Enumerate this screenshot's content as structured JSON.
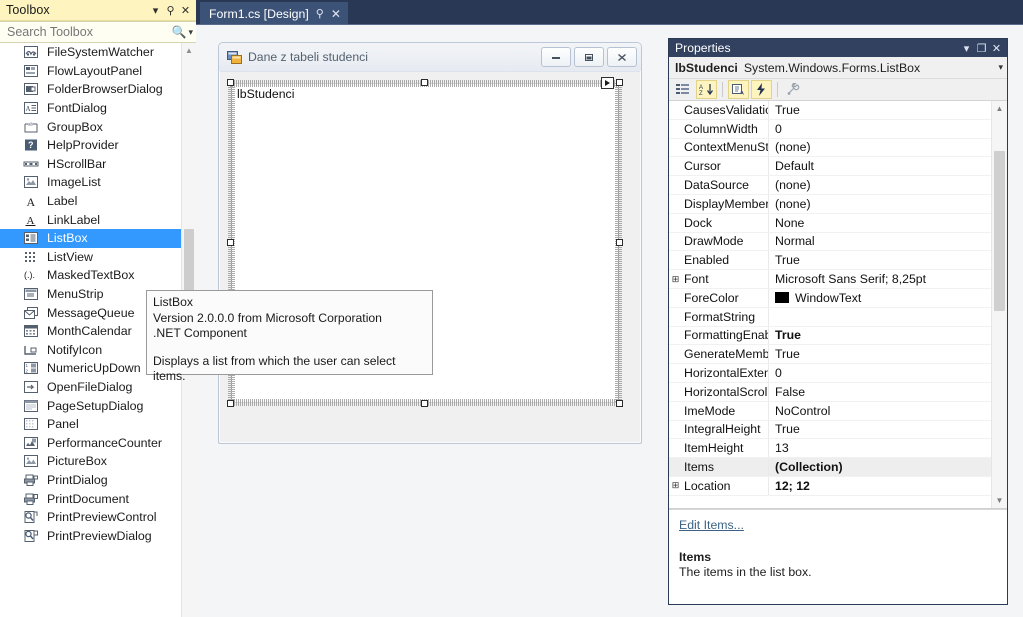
{
  "toolbox": {
    "title": "Toolbox",
    "title_icons": [
      "chevron-down-icon",
      "pin-icon",
      "close-icon"
    ],
    "search": {
      "placeholder": "Search Toolbox",
      "value": ""
    },
    "items": [
      {
        "label": "FileSystemWatcher",
        "icon": "filesystemwatcher-icon"
      },
      {
        "label": "FlowLayoutPanel",
        "icon": "flowlayoutpanel-icon"
      },
      {
        "label": "FolderBrowserDialog",
        "icon": "folderbrowserdialog-icon"
      },
      {
        "label": "FontDialog",
        "icon": "fontdialog-icon"
      },
      {
        "label": "GroupBox",
        "icon": "groupbox-icon"
      },
      {
        "label": "HelpProvider",
        "icon": "helpprovider-icon"
      },
      {
        "label": "HScrollBar",
        "icon": "hscrollbar-icon"
      },
      {
        "label": "ImageList",
        "icon": "imagelist-icon"
      },
      {
        "label": "Label",
        "icon": "label-icon"
      },
      {
        "label": "LinkLabel",
        "icon": "linklabel-icon"
      },
      {
        "label": "ListBox",
        "icon": "listbox-icon",
        "selected": true
      },
      {
        "label": "ListView",
        "icon": "listview-icon"
      },
      {
        "label": "MaskedTextBox",
        "icon": "maskedtextbox-icon"
      },
      {
        "label": "MenuStrip",
        "icon": "menustrip-icon"
      },
      {
        "label": "MessageQueue",
        "icon": "messagequeue-icon"
      },
      {
        "label": "MonthCalendar",
        "icon": "monthcalendar-icon"
      },
      {
        "label": "NotifyIcon",
        "icon": "notifyicon-icon"
      },
      {
        "label": "NumericUpDown",
        "icon": "numericupdown-icon"
      },
      {
        "label": "OpenFileDialog",
        "icon": "openfiledialog-icon"
      },
      {
        "label": "PageSetupDialog",
        "icon": "pagesetupdialog-icon"
      },
      {
        "label": "Panel",
        "icon": "panel-icon"
      },
      {
        "label": "PerformanceCounter",
        "icon": "performancecounter-icon"
      },
      {
        "label": "PictureBox",
        "icon": "picturebox-icon"
      },
      {
        "label": "PrintDialog",
        "icon": "printdialog-icon"
      },
      {
        "label": "PrintDocument",
        "icon": "printdocument-icon"
      },
      {
        "label": "PrintPreviewControl",
        "icon": "printpreviewcontrol-icon"
      },
      {
        "label": "PrintPreviewDialog",
        "icon": "printpreviewdialog-icon"
      }
    ]
  },
  "editor": {
    "tab": {
      "label": "Form1.cs [Design]",
      "pin_icon": "pin-icon",
      "close_icon": "close-icon"
    }
  },
  "form": {
    "caption": "Dane z tabeli studenci",
    "icon": "windows-form-icon",
    "buttons": [
      "minimize",
      "maximize",
      "close"
    ],
    "listbox": {
      "text": "lbStudenci",
      "smart_tag_icon": "smart-tag-arrow-icon"
    }
  },
  "tooltip": {
    "line1": "ListBox",
    "line2": "Version 2.0.0.0 from Microsoft Corporation",
    "line3": ".NET Component",
    "line4": "Displays a list from which the user can select items."
  },
  "properties": {
    "title": "Properties",
    "title_icons": [
      "chevron-down-icon",
      "maximize-icon",
      "close-icon"
    ],
    "object_name": "lbStudenci",
    "object_type": "System.Windows.Forms.ListBox",
    "object_dropdown_icon": "chevron-down-icon",
    "toolbar": [
      {
        "name": "categorized-button",
        "icon": "categorized-icon",
        "active": false
      },
      {
        "name": "alphabetical-button",
        "icon": "sort-az-icon",
        "active": true
      },
      {
        "name": "properties-button",
        "icon": "properties-page-icon",
        "active": true
      },
      {
        "name": "events-button",
        "icon": "lightning-icon",
        "active": true
      },
      {
        "name": "property-pages-button",
        "icon": "wrench-icon",
        "active": false
      }
    ],
    "rows": [
      {
        "name": "CausesValidation",
        "value": "True"
      },
      {
        "name": "ColumnWidth",
        "value": "0"
      },
      {
        "name": "ContextMenuStrip",
        "value": "(none)"
      },
      {
        "name": "Cursor",
        "value": "Default"
      },
      {
        "name": "DataSource",
        "value": "(none)"
      },
      {
        "name": "DisplayMember",
        "value": "(none)"
      },
      {
        "name": "Dock",
        "value": "None"
      },
      {
        "name": "DrawMode",
        "value": "Normal"
      },
      {
        "name": "Enabled",
        "value": "True"
      },
      {
        "name": "Font",
        "value": "Microsoft Sans Serif; 8,25pt",
        "expandable": true
      },
      {
        "name": "ForeColor",
        "value": "WindowText",
        "swatch": "#000000"
      },
      {
        "name": "FormatString",
        "value": ""
      },
      {
        "name": "FormattingEnabled",
        "value": "True",
        "bold": true
      },
      {
        "name": "GenerateMember",
        "value": "True"
      },
      {
        "name": "HorizontalExtent",
        "value": "0"
      },
      {
        "name": "HorizontalScrollbar",
        "value": "False"
      },
      {
        "name": "ImeMode",
        "value": "NoControl"
      },
      {
        "name": "IntegralHeight",
        "value": "True"
      },
      {
        "name": "ItemHeight",
        "value": "13"
      },
      {
        "name": "Items",
        "value": "(Collection)",
        "bold": true,
        "selected": true
      },
      {
        "name": "Location",
        "value": "12; 12",
        "bold": true,
        "expandable": true
      }
    ],
    "help": {
      "link": "Edit Items...",
      "heading": "Items",
      "description": "The items in the list box."
    }
  },
  "colors": {
    "toolbox_header": "#fdf4bf",
    "selection_blue": "#3399ff",
    "vs_chrome_dark": "#293955",
    "props_header": "#31415f",
    "link": "#3c6385"
  }
}
